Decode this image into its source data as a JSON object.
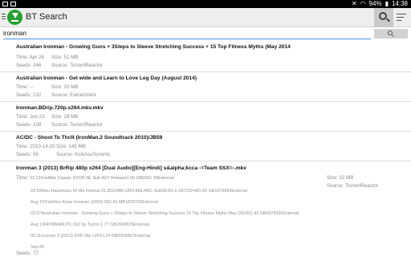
{
  "status": {
    "battery": "94%",
    "time": "14:38"
  },
  "app": {
    "title": "BT Search"
  },
  "search": {
    "value": "ironman"
  },
  "labels": {
    "time": "Time:",
    "size": "Size:",
    "seeds": "Seeds:",
    "source": "Source:"
  },
  "results": [
    {
      "title": "Australian Ironman - Growing Guns + 3Steps to Sleeve Stretching Success + 15 Top Fitness Myths (May 2014",
      "time": "Apr 24",
      "size": "51 MB",
      "seeds": "246",
      "source": "TorrentReactor"
    },
    {
      "title": "Australian Ironman - Get wide  and Learn to Love Leg Day  (August 2014)",
      "time": "--",
      "size": "32 MB",
      "seeds": "132",
      "source": "Extratorrent"
    },
    {
      "title": "Ironman.BDrip.720p.x264.mkv.mkv",
      "time": "Jun 23",
      "size": "28 MB",
      "seeds": "108",
      "source": "TorrentReactor"
    },
    {
      "title": "AC/DC - Shoot To Thrill (IronMan.2 Soundtrack 2010)/JB59",
      "time": "2010-14-20",
      "size": "145 MB",
      "seeds": "56",
      "source": "KickAssTorrents"
    },
    {
      "title": "Ironman 3 (2013) BrRip 480p x264 [Dual Audio][Eng-Hindi] s&alpha;kcca -=Team SSX=-.mkv",
      "time": "02:12IronMan Classic DVDR NL Sub NLT Release1.00 GB0901 09External",
      "size": "32 MB",
      "source": "TorrentReactor",
      "seeds": "77",
      "extra_lines": [
        "03:59Mou Hasamazu Ni Wa Ironinai 01.852x480.x264.8bit.AAC SubDESU.n.1B72SF481.82 GB1076684External",
        "Aug 15Triathlon Kona Ironman (2003) 992.43 MB1815702External",
        "02:07Australian Ironman - Growing Guns + 3Steps to Sleeve Stretching Success 15 Top Fitness Myths May (2014)1.43 GB4378936External",
        "Aug 13IRONMAN PC ISO by Tuzno 1.77 GB1660815External",
        "09:11ronman 3 (2013) DVD Rip x2641.24 GB9209897External",
        "Sep 06"
      ]
    }
  ]
}
